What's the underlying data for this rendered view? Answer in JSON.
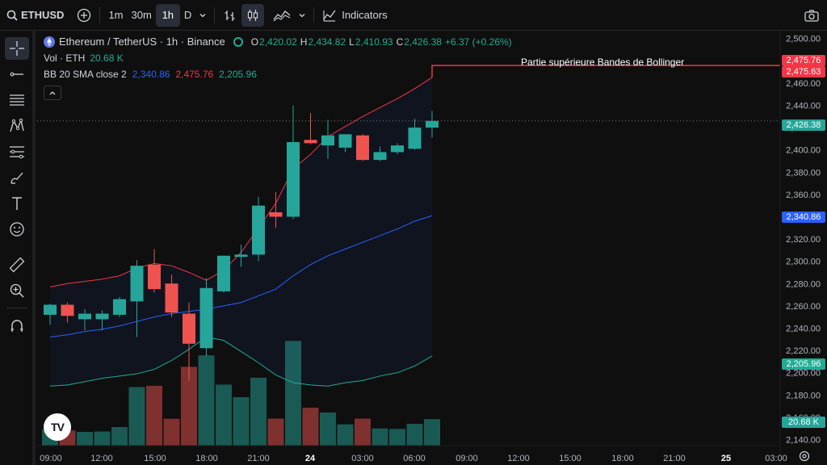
{
  "topbar": {
    "symbol": "ETHUSD",
    "intervals": [
      "1m",
      "30m",
      "1h",
      "D"
    ],
    "indicators_label": "Indicators"
  },
  "legend": {
    "title": "Ethereum / TetherUS · 1h · Binance",
    "ohlc": {
      "o_label": "O",
      "o": "2,420.02",
      "h_label": "H",
      "h": "2,434.82",
      "l_label": "L",
      "l": "2,410.93",
      "c_label": "C",
      "c": "2,426.38",
      "change": "+6.37 (+0.26%)"
    },
    "volume": {
      "label": "Vol · ETH",
      "value": "20.68 K"
    },
    "bb": {
      "label": "BB 20 SMA close 2",
      "basis": "2,340.86",
      "upper": "2,475.76",
      "lower": "2,205.96"
    }
  },
  "annotation": "Partie supérieure Bandes de Bollinger",
  "price_labels": {
    "upper_a": "2,475.76",
    "upper_b": "2,475.63",
    "last": "2,426.38",
    "basis": "2,340.86",
    "lower": "2,205.96",
    "volume": "20.68 K"
  },
  "colors": {
    "up": "#26a69a",
    "down": "#ef5350",
    "basis": "#2962ff",
    "upper": "#f23645",
    "lower": "#22ab94",
    "bg": "#0f0f0f"
  },
  "logo_text": "TV",
  "chart_data": {
    "type": "candlestick",
    "yticks": [
      "2,500.00",
      "2,480.00",
      "2,460.00",
      "2,440.00",
      "2,420.00",
      "2,400.00",
      "2,380.00",
      "2,360.00",
      "2,340.00",
      "2,320.00",
      "2,300.00",
      "2,280.00",
      "2,260.00",
      "2,240.00",
      "2,220.00",
      "2,200.00",
      "2,180.00",
      "2,160.00",
      "2,140.00"
    ],
    "xticks": [
      "09:00",
      "12:00",
      "15:00",
      "18:00",
      "21:00",
      "24",
      "03:00",
      "06:00",
      "09:00",
      "12:00",
      "15:00",
      "18:00",
      "21:00",
      "25",
      "03:00"
    ],
    "candles": [
      {
        "o": 2252,
        "h": 2262,
        "l": 2243,
        "c": 2261
      },
      {
        "o": 2261,
        "h": 2263,
        "l": 2245,
        "c": 2251
      },
      {
        "o": 2248,
        "h": 2257,
        "l": 2238,
        "c": 2253
      },
      {
        "o": 2248,
        "h": 2256,
        "l": 2238,
        "c": 2253
      },
      {
        "o": 2252,
        "h": 2268,
        "l": 2250,
        "c": 2266
      },
      {
        "o": 2264,
        "h": 2301,
        "l": 2232,
        "c": 2296
      },
      {
        "o": 2297,
        "h": 2311,
        "l": 2272,
        "c": 2275
      },
      {
        "o": 2280,
        "h": 2288,
        "l": 2250,
        "c": 2254
      },
      {
        "o": 2253,
        "h": 2263,
        "l": 2193,
        "c": 2226
      },
      {
        "o": 2222,
        "h": 2285,
        "l": 2215,
        "c": 2276
      },
      {
        "o": 2273,
        "h": 2305,
        "l": 2272,
        "c": 2305
      },
      {
        "o": 2304,
        "h": 2315,
        "l": 2295,
        "c": 2306
      },
      {
        "o": 2306,
        "h": 2358,
        "l": 2300,
        "c": 2350
      },
      {
        "o": 2344,
        "h": 2362,
        "l": 2330,
        "c": 2340
      },
      {
        "o": 2340,
        "h": 2440,
        "l": 2338,
        "c": 2407
      },
      {
        "o": 2409,
        "h": 2433,
        "l": 2405,
        "c": 2406
      },
      {
        "o": 2404,
        "h": 2427,
        "l": 2392,
        "c": 2413
      },
      {
        "o": 2402,
        "h": 2414,
        "l": 2398,
        "c": 2414
      },
      {
        "o": 2413,
        "h": 2414,
        "l": 2390,
        "c": 2391
      },
      {
        "o": 2391,
        "h": 2403,
        "l": 2390,
        "c": 2398
      },
      {
        "o": 2398,
        "h": 2406,
        "l": 2396,
        "c": 2404
      },
      {
        "o": 2401,
        "h": 2428,
        "l": 2400,
        "c": 2420
      },
      {
        "o": 2420,
        "h": 2435,
        "l": 2411,
        "c": 2426
      }
    ],
    "bb_upper": [
      2277,
      2280,
      2282,
      2284,
      2287,
      2294,
      2298,
      2296,
      2290,
      2283,
      2292,
      2308,
      2330,
      2352,
      2383,
      2396,
      2412,
      2421,
      2430,
      2438,
      2446,
      2455,
      2465
    ],
    "bb_basis": [
      2232,
      2234,
      2237,
      2239,
      2242,
      2246,
      2250,
      2253,
      2255,
      2257,
      2260,
      2263,
      2269,
      2275,
      2287,
      2297,
      2305,
      2311,
      2317,
      2323,
      2329,
      2336,
      2341
    ],
    "bb_lower": [
      2188,
      2189,
      2192,
      2195,
      2197,
      2199,
      2203,
      2211,
      2221,
      2232,
      2229,
      2219,
      2209,
      2198,
      2191,
      2189,
      2188,
      2191,
      2193,
      2197,
      2200,
      2206,
      2215
    ],
    "bb_upper_extension": 2475.76,
    "volume": [
      12.5,
      11.8,
      10.7,
      11.0,
      14.5,
      45.7,
      46.7,
      21.0,
      61.5,
      70.4,
      47.6,
      37.8,
      53.0,
      21.1,
      81.7,
      29.6,
      25.8,
      16.6,
      21.1,
      13.4,
      13.0,
      17.0,
      20.68
    ],
    "ylim": [
      2136,
      2507
    ],
    "volume_max": 80.0
  }
}
